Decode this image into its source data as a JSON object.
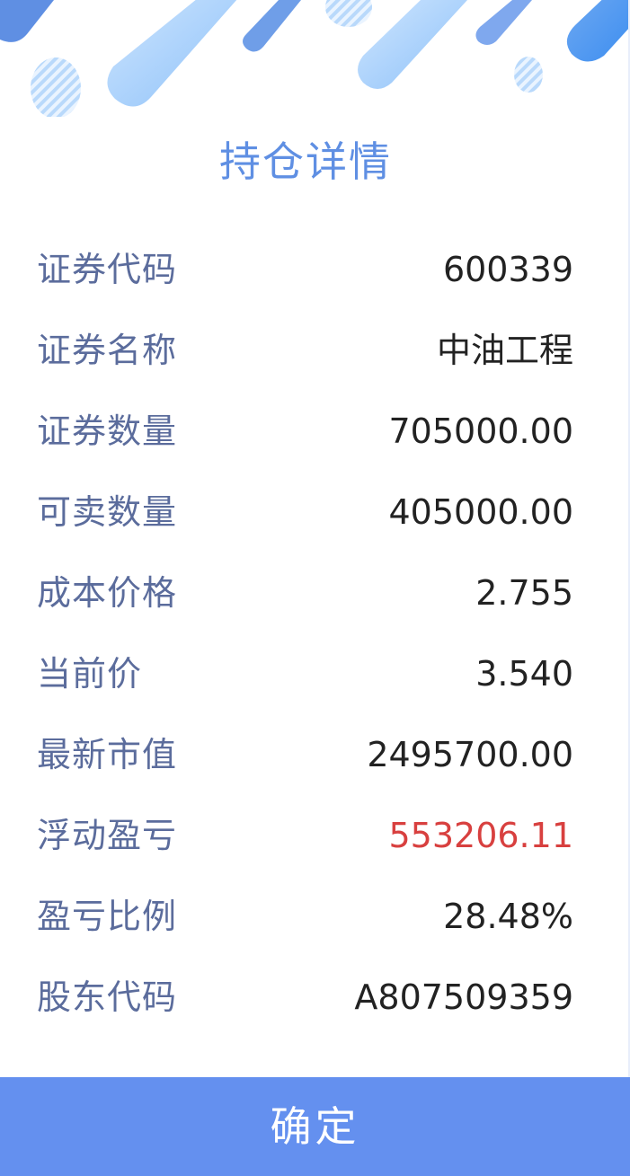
{
  "dialog": {
    "title": "持仓详情",
    "confirm_label": "确定"
  },
  "rows": [
    {
      "label": "证券代码",
      "value": "600339"
    },
    {
      "label": "证券名称",
      "value": "中油工程"
    },
    {
      "label": "证券数量",
      "value": "705000.00"
    },
    {
      "label": "可卖数量",
      "value": "405000.00"
    },
    {
      "label": "成本价格",
      "value": "2.755"
    },
    {
      "label": "当前价",
      "value": "3.540"
    },
    {
      "label": "最新市值",
      "value": "2495700.00"
    },
    {
      "label": "浮动盈亏",
      "value": "553206.11",
      "color": "#d8403f"
    },
    {
      "label": "盈亏比例",
      "value": "28.48%"
    },
    {
      "label": "股东代码",
      "value": "A807509359"
    }
  ],
  "colors": {
    "title": "#5f8fe3",
    "label": "#5b6c9c",
    "value": "#222222",
    "profit": "#d8403f",
    "button": "#6490ef"
  }
}
